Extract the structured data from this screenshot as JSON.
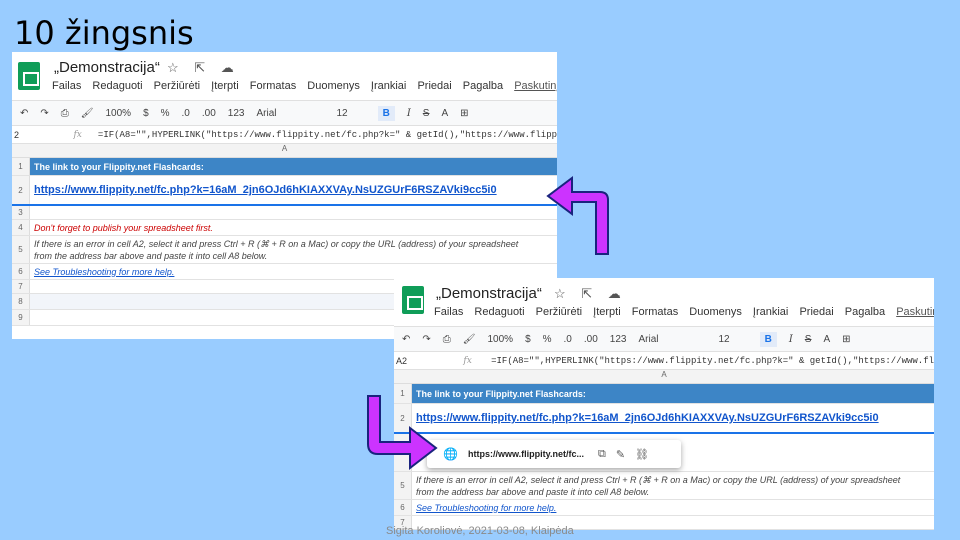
{
  "slide": {
    "title": "10 žingsnis",
    "footer": "Sigita Koroliovė, 2021-03-08, Klaipėda"
  },
  "sheet": {
    "doc_title": "„Demonstracija“",
    "title_icons": "☆ ⇱ ☁",
    "menu": [
      "Failas",
      "Redaguoti",
      "Peržiūrėti",
      "Įterpti",
      "Formatas",
      "Duomenys",
      "Įrankiai",
      "Priedai",
      "Pagalba"
    ],
    "menu_last": "Paskutinį k",
    "toolbar": {
      "undo": "↶",
      "redo": "↷",
      "print": "⎙",
      "paint": "🖌",
      "zoom": "100%",
      "currency": "$",
      "percent": "%",
      "dec_less": ".0",
      "dec_more": ".00",
      "format": "123",
      "font": "Arial",
      "size": "12",
      "bold": "B",
      "italic": "I",
      "strike": "S",
      "color": "A",
      "grid": "⊞"
    },
    "cell_ref_1": "2",
    "cell_ref_2": "A2",
    "fx": "fx",
    "formula": "=IF(A8=\"\",HYPERLINK(\"https://www.flippity.net/fc.php?k=\" & getId(),\"https://www.flipp",
    "formula_2": "=IF(A8=\"\",HYPERLINK(\"https://www.flippity.net/fc.php?k=\" & getId(),\"https://www.fl",
    "col_a": "A",
    "row1_num": "1",
    "row1_text": "The link to your Flippity.net Flashcards:",
    "row2_num": "2",
    "row2_text": "https://www.flippity.net/fc.php?k=16aM_2jn6OJd6hKIAXXVAy.NsUZGUrF6RSZAVki9cc5i0",
    "row3_num": "3",
    "row4_num": "4",
    "row4_text": "Don't forget to publish your spreadsheet first.",
    "row5_num": "5",
    "row5_text": "If there is an error in cell A2, select it and press Ctrl + R (⌘ + R on a Mac) or copy the URL (address) of your spreadsheet from the address bar above and paste it into cell A8 below.",
    "row6_num": "6",
    "row6_text": "See Troubleshooting for more help.",
    "row7_num": "7",
    "row8_num": "8",
    "row9_num": "9"
  },
  "popup": {
    "globe": "🌐",
    "url": "https://www.flippity.net/fc...",
    "copy": "⧉",
    "edit": "✎",
    "unlink": "⛓"
  },
  "colors": {
    "background": "#99ccff",
    "arrow": "#cc33ff",
    "header_fill": "#3d85c6",
    "link": "#1155cc"
  }
}
